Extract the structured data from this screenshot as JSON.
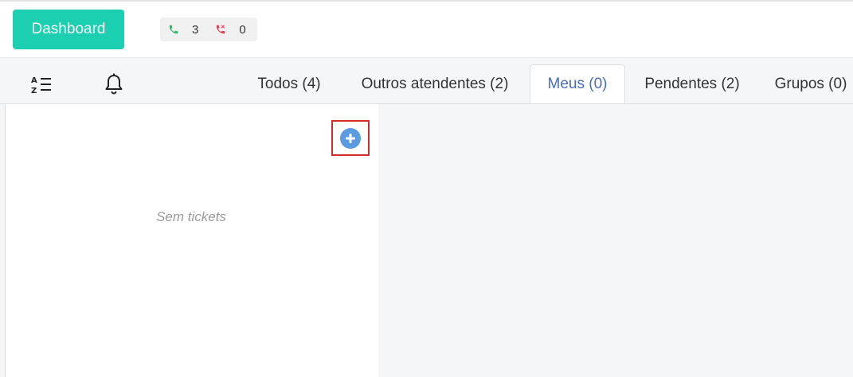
{
  "header": {
    "dashboard_label": "Dashboard",
    "calls": {
      "answered_icon": "phone-icon",
      "answered_count": "3",
      "missed_icon": "phone-missed-icon",
      "missed_count": "0"
    }
  },
  "toolbar": {
    "sort_icon": "sort-alpha-icon",
    "notifications_icon": "bell-icon"
  },
  "tabs": [
    {
      "label": "Todos (4)"
    },
    {
      "label": "Outros atendentes (2)"
    },
    {
      "label": "Meus (0)",
      "active": true
    },
    {
      "label": "Pendentes (2)"
    },
    {
      "label": "Grupos (0)"
    }
  ],
  "ticket_list": {
    "add_icon": "plus-circle-icon",
    "empty_message": "Sem tickets"
  },
  "colors": {
    "accent": "#1ccfb0",
    "active_tab": "#4a6bbf",
    "add_button": "#5b9be0",
    "highlight": "#d42b2b"
  }
}
